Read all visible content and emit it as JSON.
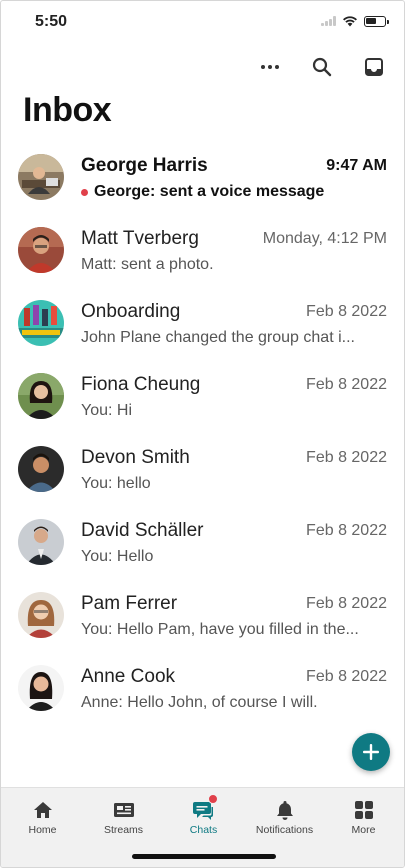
{
  "status_bar": {
    "time": "5:50"
  },
  "header": {
    "title": "Inbox"
  },
  "conversations": [
    {
      "name": "George Harris",
      "date": "9:47 AM",
      "preview": "George: sent a voice message",
      "unread": true
    },
    {
      "name": "Matt Tverberg",
      "date": "Monday, 4:12 PM",
      "preview": "Matt: sent a photo."
    },
    {
      "name": "Onboarding",
      "date": "Feb 8 2022",
      "preview": "John Plane changed the group chat i..."
    },
    {
      "name": "Fiona Cheung",
      "date": "Feb 8 2022",
      "preview": "You: Hi"
    },
    {
      "name": "Devon Smith",
      "date": "Feb 8 2022",
      "preview": "You: hello"
    },
    {
      "name": "David Schäller",
      "date": "Feb 8 2022",
      "preview": "You: Hello"
    },
    {
      "name": "Pam Ferrer",
      "date": "Feb 8 2022",
      "preview": "You: Hello Pam, have you filled in the..."
    },
    {
      "name": "Anne Cook",
      "date": "Feb 8 2022",
      "preview": "Anne: Hello John, of course I will."
    }
  ],
  "tabs": [
    {
      "label": "Home",
      "icon": "home-icon"
    },
    {
      "label": "Streams",
      "icon": "streams-icon"
    },
    {
      "label": "Chats",
      "icon": "chats-icon",
      "active": true,
      "badge": true
    },
    {
      "label": "Notifications",
      "icon": "bell-icon"
    },
    {
      "label": "More",
      "icon": "grid-icon"
    }
  ],
  "colors": {
    "accent": "#0f7a83",
    "unread_dot": "#e0404a",
    "tab_bar": "#f1f1f1"
  }
}
